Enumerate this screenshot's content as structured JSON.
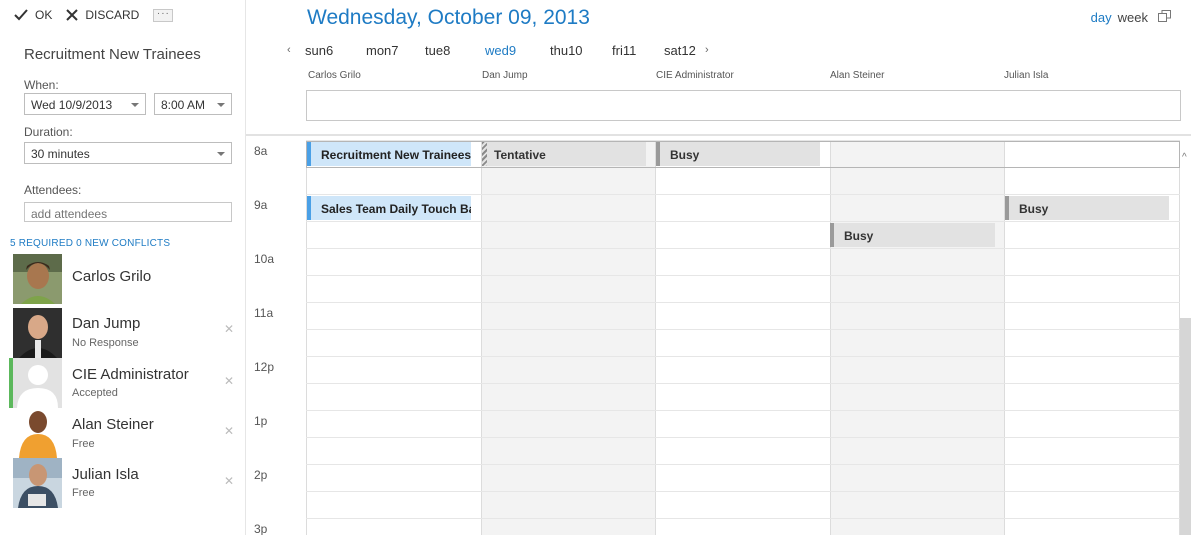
{
  "toolbar": {
    "ok_label": "OK",
    "discard_label": "DISCARD",
    "more_label": "···"
  },
  "meeting": {
    "title": "Recruitment New Trainees",
    "when_label": "When:",
    "date_value": "Wed 10/9/2013",
    "time_value": "8:00 AM",
    "duration_label": "Duration:",
    "duration_value": "30 minutes",
    "attendees_label": "Attendees:",
    "attendees_placeholder": "add attendees",
    "conflicts_text": "5 REQUIRED 0 NEW CONFLICTS"
  },
  "attendees": [
    {
      "name": "Carlos Grilo",
      "status": ""
    },
    {
      "name": "Dan Jump",
      "status": "No Response"
    },
    {
      "name": "CIE Administrator",
      "status": "Accepted"
    },
    {
      "name": "Alan Steiner",
      "status": "Free"
    },
    {
      "name": "Julian Isla",
      "status": "Free"
    }
  ],
  "header": {
    "date_title": "Wednesday, October 09, 2013",
    "view_day": "day",
    "view_week": "week",
    "active_view": "day",
    "prev_arrow": "‹",
    "next_arrow": "›",
    "days": [
      "sun6",
      "mon7",
      "tue8",
      "wed9",
      "thu10",
      "fri11",
      "sat12"
    ],
    "selected_day": "wed9",
    "columns": [
      "Carlos Grilo",
      "Dan Jump",
      "CIE Administrator",
      "Alan Steiner",
      "Julian Isla"
    ]
  },
  "grid": {
    "hours": [
      "8a",
      "9a",
      "10a",
      "11a",
      "12p",
      "1p",
      "2p",
      "3p"
    ],
    "events": [
      {
        "column": "Carlos Grilo",
        "label": "Recruitment New Trainees",
        "start": "8:00",
        "kind": "meeting"
      },
      {
        "column": "Dan Jump",
        "label": "Tentative",
        "start": "8:00",
        "kind": "tentative"
      },
      {
        "column": "CIE Administrator",
        "label": "Busy",
        "start": "8:00",
        "kind": "busy"
      },
      {
        "column": "Carlos Grilo",
        "label": "Sales Team Daily Touch Base",
        "start": "9:00",
        "kind": "meeting"
      },
      {
        "column": "Julian Isla",
        "label": "Busy",
        "start": "9:00",
        "kind": "busy"
      },
      {
        "column": "Alan Steiner",
        "label": "Busy",
        "start": "9:30",
        "kind": "busy"
      }
    ]
  },
  "colors": {
    "accent": "#1e7bc4",
    "meeting_fill": "#cfe6f9",
    "meeting_bar": "#4aa0e6",
    "busy_fill": "#e2e2e2",
    "accepted_bar": "#5cb85c"
  }
}
